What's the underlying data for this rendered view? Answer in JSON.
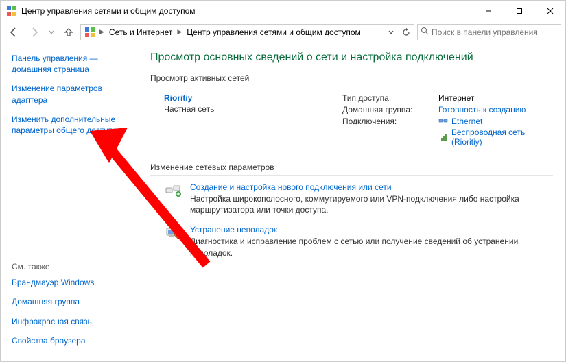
{
  "window": {
    "title": "Центр управления сетями и общим доступом"
  },
  "breadcrumb": {
    "level1": "Сеть и Интернет",
    "level2": "Центр управления сетями и общим доступом"
  },
  "search": {
    "placeholder": "Поиск в панели управления"
  },
  "sidebar": {
    "home": "Панель управления — домашняя страница",
    "adapter": "Изменение параметров адаптера",
    "advanced": "Изменить дополнительные параметры общего доступа",
    "see_also_title": "См. также",
    "see_also": {
      "firewall": "Брандмауэр Windows",
      "homegroup": "Домашняя группа",
      "infrared": "Инфракрасная связь",
      "browser": "Свойства браузера"
    }
  },
  "main": {
    "page_title": "Просмотр основных сведений о сети и настройка подключений",
    "active_heading": "Просмотр активных сетей",
    "network": {
      "name": "Rioritiy",
      "type": "Частная сеть",
      "access_label": "Тип доступа:",
      "access_value": "Интернет",
      "homegroup_label": "Домашняя группа:",
      "homegroup_value": "Готовность к созданию",
      "connections_label": "Подключения:",
      "conn1": "Ethernet",
      "conn2": "Беспроводная сеть (Rioritiy)"
    },
    "params_heading": "Изменение сетевых параметров",
    "action1": {
      "title": "Создание и настройка нового подключения или сети",
      "desc": "Настройка широкополосного, коммутируемого или VPN-подключения либо настройка маршрутизатора или точки доступа."
    },
    "action2": {
      "title": "Устранение неполадок",
      "desc": "Диагностика и исправление проблем с сетью или получение сведений об устранении неполадок."
    }
  }
}
